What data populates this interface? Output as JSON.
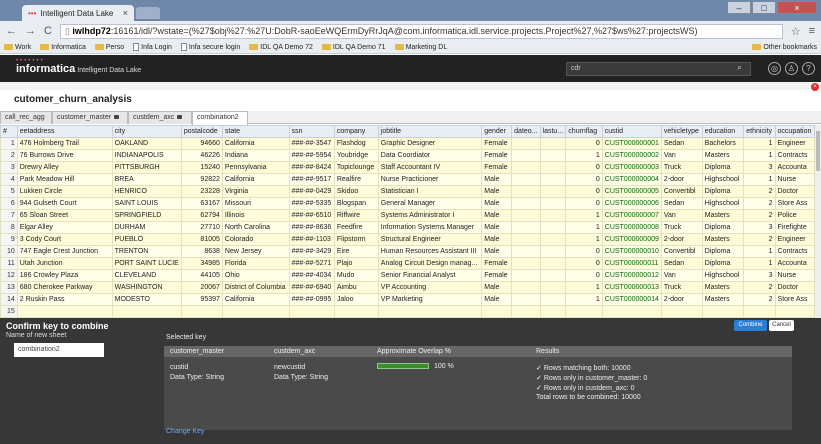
{
  "browser": {
    "tab_title": "Intelligent Data Lake",
    "url_host": "iwlhdp72",
    "url_rest": ":16161/idl/?wstate=(%27$obj%27:%27U:DobR-saoEeWQErmDyRrJqA@com.informatica.idl.service.projects.Project%27,%27$ws%27:projectsWS)",
    "bookmarks": [
      "Work",
      "Informatica",
      "Perso",
      "Infa Login",
      "Infa secure login",
      "IDL QA Demo 72",
      "IDL QA Demo 71",
      "Marketing DL"
    ],
    "other_bookmarks": "Other bookmarks"
  },
  "app": {
    "brand": "informatica",
    "product": "Intelligent Data Lake",
    "search_value": "cdr"
  },
  "page": {
    "title": "cutomer_churn_analysis",
    "tabs": [
      "call_rec_agg",
      "customer_master",
      "custdem_axc",
      "combination2"
    ]
  },
  "grid": {
    "columns": [
      "#",
      "eetaddress",
      "city",
      "postalcode",
      "state",
      "ssn",
      "company",
      "jobtitle",
      "gender",
      "dateo...",
      "lastu...",
      "churnflag",
      "custid",
      "vehicletype",
      "education",
      "ethnicity",
      "occupation"
    ],
    "rows": [
      [
        "1",
        "476 Holmberg Trail",
        "OAKLAND",
        "94660",
        "California",
        "###-##-3547",
        "Flashdog",
        "Graphic Designer",
        "Female",
        "",
        "",
        "0",
        "CUST000000001",
        "Sedan",
        "Bachelors",
        "1",
        "Engineer"
      ],
      [
        "2",
        "76 Burrows Drive",
        "INDIANAPOLIS",
        "46226",
        "Indiana",
        "###-##-5954",
        "Youbridge",
        "Data Coordiator",
        "Female",
        "",
        "",
        "1",
        "CUST000000002",
        "Van",
        "Masters",
        "1",
        "Contracts"
      ],
      [
        "3",
        "Drewry Alley",
        "PITTSBURGH",
        "15240",
        "Pennsylvania",
        "###-##-8424",
        "Topiclounge",
        "Staff Accountant IV",
        "Female",
        "",
        "",
        "0",
        "CUST000000003",
        "Truck",
        "Diploma",
        "3",
        "Accounta"
      ],
      [
        "4",
        "Park Meadow Hill",
        "BREA",
        "92822",
        "California",
        "###-##-9517",
        "Realfire",
        "Nurse Practicioner",
        "Male",
        "",
        "",
        "0",
        "CUST000000004",
        "2-door",
        "Highschool",
        "1",
        "Nurse"
      ],
      [
        "5",
        "Lukken Circle",
        "HENRICO",
        "23228",
        "Virginia",
        "###-##-0429",
        "Skidoo",
        "Statistician I",
        "Male",
        "",
        "",
        "0",
        "CUST000000005",
        "Convertibl",
        "Diploma",
        "2",
        "Doctor"
      ],
      [
        "6",
        "944 Gulseth Court",
        "SAINT LOUIS",
        "63167",
        "Missouri",
        "###-##-5335",
        "Blogspan",
        "General Manager",
        "Male",
        "",
        "",
        "0",
        "CUST000000006",
        "Sedan",
        "Highschool",
        "2",
        "Store Ass"
      ],
      [
        "7",
        "65 Sloan Street",
        "SPRINGFIELD",
        "62794",
        "Illinois",
        "###-##-6510",
        "Riffwire",
        "Systems Administrator I",
        "Male",
        "",
        "",
        "1",
        "CUST000000007",
        "Van",
        "Masters",
        "2",
        "Police"
      ],
      [
        "8",
        "Elgar Alley",
        "DURHAM",
        "27710",
        "North Carolina",
        "###-##-8636",
        "Feedfire",
        "Information Systems Manager",
        "Male",
        "",
        "",
        "1",
        "CUST000000008",
        "Truck",
        "Diploma",
        "3",
        "Firefighte"
      ],
      [
        "9",
        "3 Cody Court",
        "PUEBLO",
        "81005",
        "Colorado",
        "###-##-1103",
        "Flipstorm",
        "Structural Engineer",
        "Male",
        "",
        "",
        "1",
        "CUST000000009",
        "2-door",
        "Masters",
        "2",
        "Engineer"
      ],
      [
        "10",
        "747 Eagle Crest Junction",
        "TRENTON",
        "8638",
        "New Jersey",
        "###-##-3429",
        "Eire",
        "Human Resources Assistant III",
        "Male",
        "",
        "",
        "0",
        "CUST000000010",
        "Convertibl",
        "Diploma",
        "1",
        "Contracts"
      ],
      [
        "11",
        "Utah Junction",
        "PORT SAINT LUCIE",
        "34985",
        "Florida",
        "###-##-5271",
        "Plajo",
        "Analog Circuit Design manag...",
        "Female",
        "",
        "",
        "0",
        "CUST000000011",
        "Sedan",
        "Diploma",
        "1",
        "Accounta"
      ],
      [
        "12",
        "186 Crowley Plaza",
        "CLEVELAND",
        "44105",
        "Ohio",
        "###-##-4034",
        "Mudo",
        "Senior Financial Analyst",
        "Female",
        "",
        "",
        "0",
        "CUST000000012",
        "Van",
        "Highschool",
        "3",
        "Nurse"
      ],
      [
        "13",
        "680 Cherokee Parkway",
        "WASHINGTON",
        "20067",
        "District of Columbia",
        "###-##-6940",
        "Aimbu",
        "VP Accounting",
        "Male",
        "",
        "",
        "1",
        "CUST000000013",
        "Truck",
        "Masters",
        "2",
        "Doctor"
      ],
      [
        "14",
        "2 Ruskin Pass",
        "MODESTO",
        "95397",
        "California",
        "###-##-0995",
        "Jaloo",
        "VP Marketing",
        "Male",
        "",
        "",
        "1",
        "CUST000000014",
        "2-door",
        "Masters",
        "2",
        "Store Ass"
      ],
      [
        "15",
        "",
        "",
        "",
        "",
        "",
        "",
        "",
        "",
        "",
        "",
        "",
        "",
        "",
        "",
        "",
        ""
      ]
    ]
  },
  "dialog": {
    "title": "Confirm key to combine",
    "name_label": "Name of new sheet",
    "name_value": "combination2",
    "combine_label": "Combine",
    "cancel_label": "Cancel",
    "selected_key_label": "Selected key",
    "headers": {
      "left": "customer_master",
      "right": "custdem_axc",
      "overlap": "Approximate Overlap %",
      "results": "Results"
    },
    "left_key": "custid",
    "left_type": "Data Type: String",
    "right_key": "newcustid",
    "right_type": "Data Type: String",
    "overlap_value": "100 %",
    "results": [
      "Rows matching both:   10000",
      "Rows only in customer_master:   0",
      "Rows only in custdem_axc:   0",
      "Total rows to be combined: 10000"
    ],
    "change_key": "Change Key"
  },
  "colors": {
    "accent": "#2a7fd4",
    "header_bg": "#222222",
    "row_bg": "#fdfbd8",
    "overlap_bar": "#3d8a2a"
  }
}
